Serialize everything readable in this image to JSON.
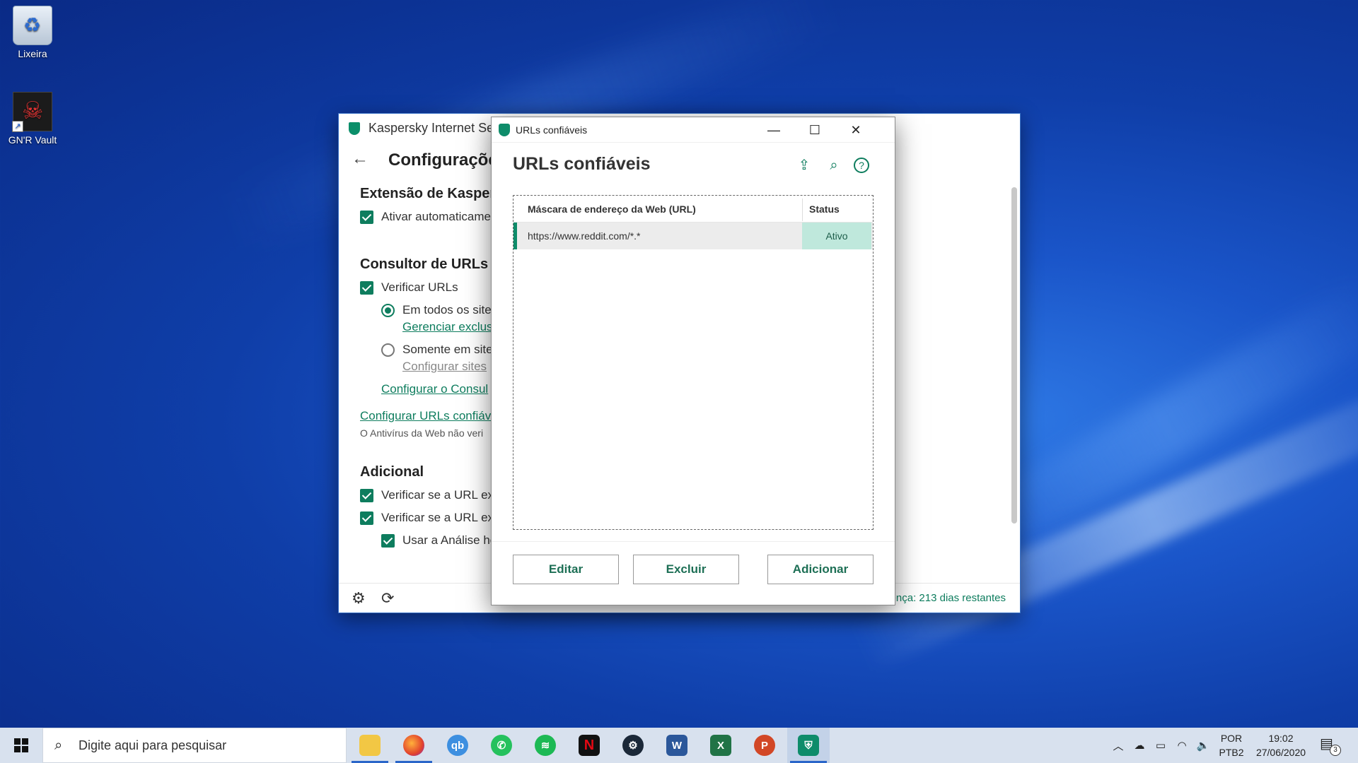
{
  "desktop": {
    "icons": [
      {
        "label": "Lixeira",
        "icon": "recycle-bin-icon"
      },
      {
        "label": "GN'R Vault",
        "icon": "gnr-vault-icon"
      }
    ]
  },
  "main_window": {
    "title": "Kaspersky Internet Security",
    "title_visible": "Kaspersky Internet Sec",
    "controls": {
      "help": "?",
      "minimize": "—",
      "close": "✕"
    },
    "header": {
      "back": "←",
      "title": "Configurações"
    },
    "sections": [
      {
        "title": "Extensão de Kaspersky",
        "title_visible": "Extensão de Kaspers"
      },
      {
        "title": "Consultor de URLs"
      },
      {
        "title": "Adicional"
      }
    ],
    "items": {
      "auto_activate": "Ativar automaticame",
      "check_urls": "Verificar URLs",
      "all_sites": "Em todos os site",
      "manage_exclusions": "Gerenciar exclus",
      "only_sites": "Somente em site",
      "configure_sites": "Configurar sites",
      "configure_consultant": "Configurar o Consul",
      "configure_trusted": "Configurar URLs confiáv",
      "antivirus_note": "O Antivírus da Web não veri",
      "check_url_1": "Verificar se a URL ex",
      "check_url_2": "Verificar se a URL ex",
      "use_analysis": "Usar a Análise he"
    },
    "footer": {
      "license": "ença: 213 dias restantes"
    }
  },
  "dialog": {
    "window_title": "URLs confiáveis",
    "heading": "URLs confiáveis",
    "controls": {
      "minimize": "—",
      "maximize": "☐",
      "close": "✕"
    },
    "table": {
      "columns": [
        "Máscara de endereço da Web (URL)",
        "Status"
      ],
      "rows": [
        {
          "mask": "https://www.reddit.com/*.*",
          "status": "Ativo"
        }
      ]
    },
    "buttons": {
      "edit": "Editar",
      "delete": "Excluir",
      "add": "Adicionar"
    }
  },
  "taskbar": {
    "search_placeholder": "Digite aqui para pesquisar",
    "apps": [
      {
        "name": "file-explorer",
        "label": ""
      },
      {
        "name": "firefox",
        "label": ""
      },
      {
        "name": "qbittorrent",
        "label": "qb"
      },
      {
        "name": "whatsapp",
        "label": ""
      },
      {
        "name": "spotify",
        "label": ""
      },
      {
        "name": "netflix",
        "label": "N"
      },
      {
        "name": "steam",
        "label": ""
      },
      {
        "name": "word",
        "label": "W"
      },
      {
        "name": "excel",
        "label": "X"
      },
      {
        "name": "powerpoint",
        "label": "P"
      },
      {
        "name": "kaspersky",
        "label": ""
      }
    ],
    "lang_top": "POR",
    "lang_bottom": "PTB2",
    "time": "19:02",
    "date": "27/06/2020",
    "notifications": "3"
  }
}
